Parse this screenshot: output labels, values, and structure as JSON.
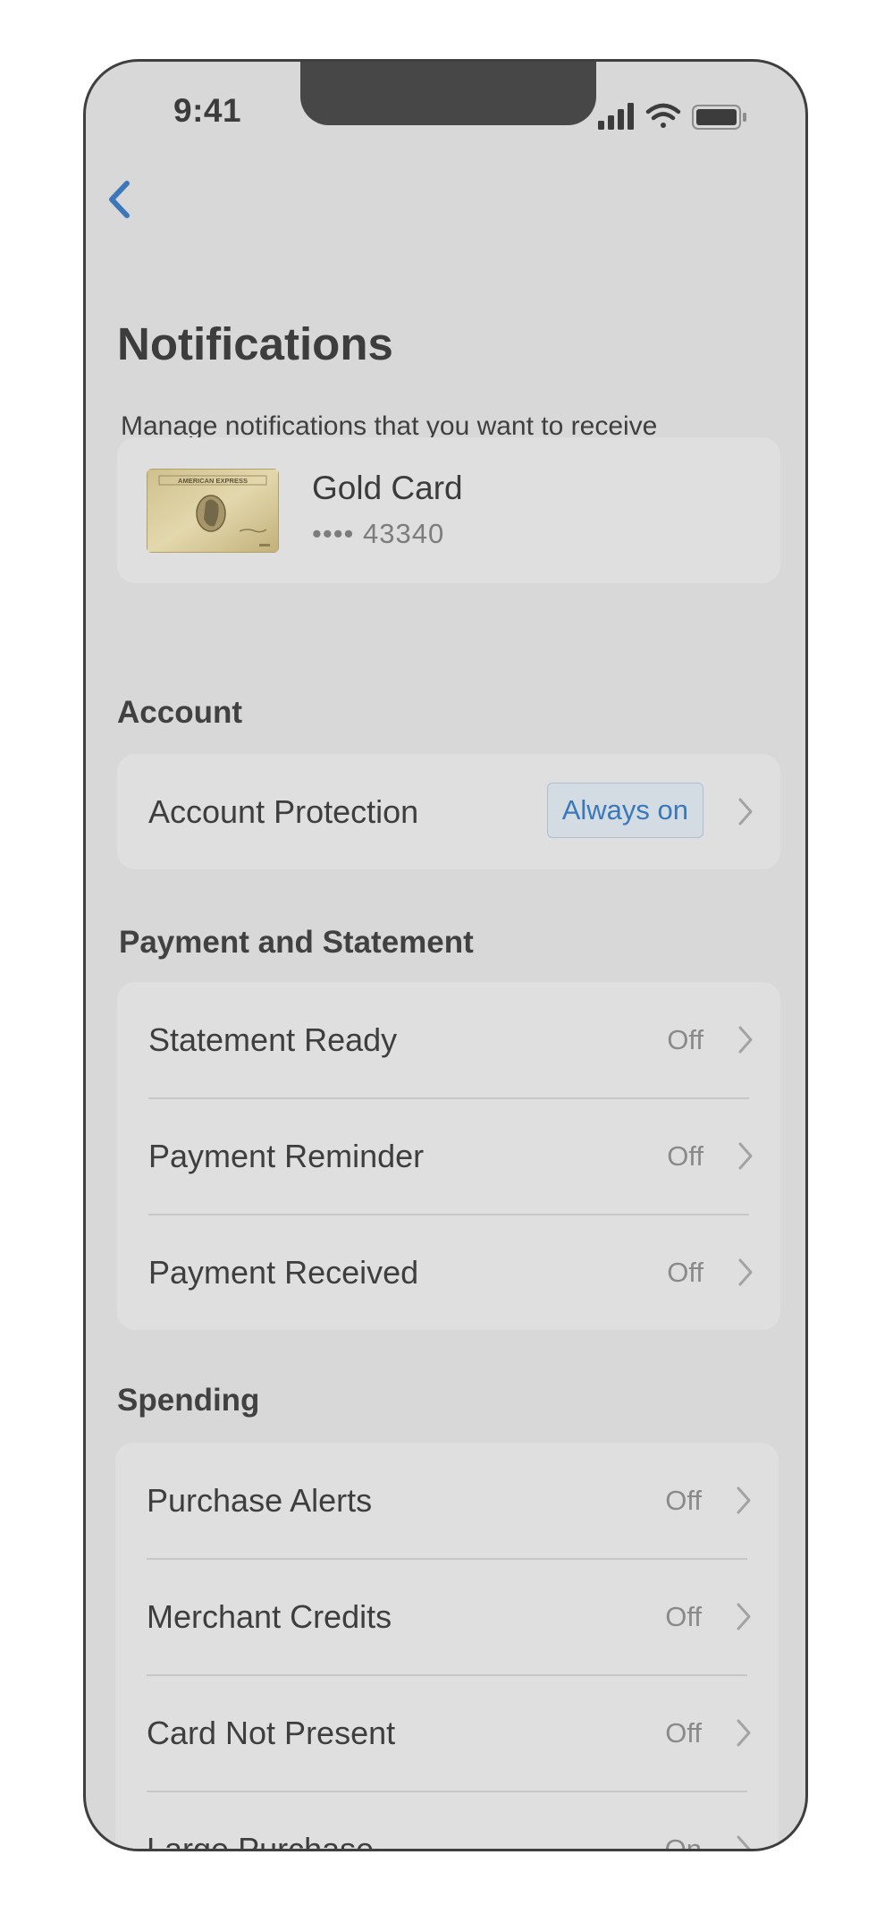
{
  "status_bar": {
    "time": "9:41",
    "signal_icon": "cellular-signal-icon",
    "wifi_icon": "wifi-icon",
    "battery_icon": "battery-icon"
  },
  "navigation": {
    "back_icon": "chevron-left-icon"
  },
  "header": {
    "title": "Notifications",
    "subtitle": "Manage notifications that you want to receive"
  },
  "card": {
    "name": "Gold Card",
    "number": "•••• 43340",
    "image_text": "AMERICAN EXPRESS"
  },
  "sections": {
    "account": {
      "title": "Account",
      "rows": [
        {
          "label": "Account Protection",
          "value": "Always on"
        }
      ]
    },
    "payment": {
      "title": "Payment and Statement",
      "rows": [
        {
          "label": "Statement Ready",
          "value": "Off"
        },
        {
          "label": "Payment Reminder",
          "value": "Off"
        },
        {
          "label": "Payment Received",
          "value": "Off"
        }
      ]
    },
    "spending": {
      "title": "Spending",
      "rows": [
        {
          "label": "Purchase Alerts",
          "value": "Off"
        },
        {
          "label": "Merchant Credits",
          "value": "Off"
        },
        {
          "label": "Card Not Present",
          "value": "Off"
        },
        {
          "label": "Large Purchase",
          "value": "On"
        }
      ]
    }
  },
  "colors": {
    "accent": "#3b78ba",
    "screen_bg": "#d8d8d8",
    "group_bg": "#dfdfdf",
    "value_text": "#8a8a8a"
  }
}
